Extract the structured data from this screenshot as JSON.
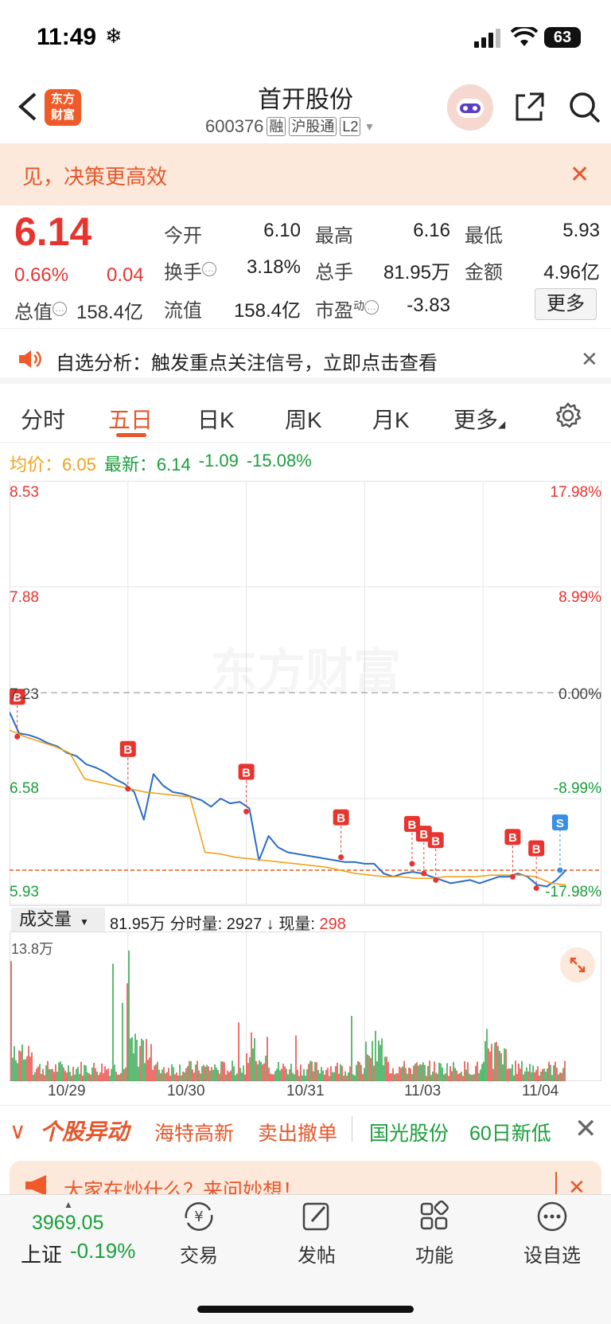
{
  "status_bar": {
    "time": "11:49",
    "battery": "63"
  },
  "header": {
    "logo_line1": "东方",
    "logo_line2": "财富",
    "stock_name": "首开股份",
    "stock_code": "600376",
    "tags": [
      "融",
      "沪股通",
      "L2"
    ]
  },
  "banner": {
    "text": "见，决策更高效"
  },
  "quote": {
    "price": "6.14",
    "pct": "0.66%",
    "change": "0.04",
    "open_label": "今开",
    "open": "6.10",
    "high_label": "最高",
    "high": "6.16",
    "low_label": "最低",
    "low": "5.93",
    "turnover_label": "换手",
    "turnover": "3.18%",
    "volume_label": "总手",
    "volume": "81.95万",
    "amount_label": "金额",
    "amount": "4.96亿",
    "mktcap_label": "总值",
    "mktcap": "158.4亿",
    "float_label": "流值",
    "float": "158.4亿",
    "pe_label": "市盈",
    "pe_sup": "动",
    "pe": "-3.83",
    "more": "更多"
  },
  "alert": {
    "text": "自选分析：触发重点关注信号，立即点击查看"
  },
  "tabs": [
    "分时",
    "五日",
    "日K",
    "周K",
    "月K",
    "更多"
  ],
  "legend": {
    "avg_label": "均价：",
    "avg": "6.05",
    "latest_label": "最新：",
    "latest": "6.14",
    "chg": "-1.09",
    "pct": "-15.08%"
  },
  "chart_data": {
    "type": "line",
    "title": "",
    "x_ticks": [
      "10/29",
      "10/30",
      "10/31",
      "11/03",
      "11/04"
    ],
    "y_left": [
      "8.53",
      "7.88",
      "7.23",
      "6.58",
      "5.93"
    ],
    "y_right": [
      "17.98%",
      "8.99%",
      "0.00%",
      "-8.99%",
      "-17.98%"
    ],
    "ylim": [
      5.93,
      8.53
    ],
    "reference_price": 7.23,
    "current_price": 6.14,
    "series": [
      {
        "name": "",
        "color": "#2b6cc4",
        "values": [
          7.11,
          6.98,
          6.97,
          6.95,
          6.92,
          6.9,
          6.86,
          6.84,
          6.79,
          6.77,
          6.74,
          6.7,
          6.67,
          6.62,
          6.45,
          6.73,
          6.66,
          6.62,
          6.61,
          6.59,
          6.57,
          6.53,
          6.58,
          6.55,
          6.56,
          6.52,
          6.2,
          6.35,
          6.28,
          6.25,
          6.24,
          6.23,
          6.22,
          6.21,
          6.2,
          6.19,
          6.19,
          6.18,
          6.18,
          6.12,
          6.1,
          6.12,
          6.13,
          6.12,
          6.1,
          6.08,
          6.06,
          6.07,
          6.08,
          6.06,
          6.08,
          6.1,
          6.1,
          6.12,
          6.1,
          6.05,
          6.04,
          6.08,
          6.14
        ]
      },
      {
        "name": "",
        "color": "#f0a21a",
        "values": [
          7.0,
          6.96,
          6.93,
          6.9,
          6.86,
          6.7,
          6.68,
          6.66,
          6.64,
          6.62,
          6.61,
          6.6,
          6.59,
          6.25,
          6.24,
          6.22,
          6.21,
          6.2,
          6.19,
          6.18,
          6.17,
          6.16,
          6.14,
          6.12,
          6.11,
          6.1,
          6.1,
          6.09,
          6.09,
          6.1,
          6.1,
          6.1,
          6.11,
          6.11,
          6.11,
          6.1,
          6.06,
          6.05
        ]
      }
    ],
    "markers": [
      {
        "label": "B",
        "x": 0.013,
        "price": 6.96
      },
      {
        "label": "B",
        "x": 0.2,
        "price": 6.64
      },
      {
        "label": "B",
        "x": 0.4,
        "price": 6.5
      },
      {
        "label": "B",
        "x": 0.56,
        "price": 6.22
      },
      {
        "label": "B",
        "x": 0.68,
        "price": 6.18
      },
      {
        "label": "B",
        "x": 0.7,
        "price": 6.12
      },
      {
        "label": "B",
        "x": 0.72,
        "price": 6.08
      },
      {
        "label": "B",
        "x": 0.85,
        "price": 6.1
      },
      {
        "label": "B",
        "x": 0.89,
        "price": 6.03
      },
      {
        "label": "S",
        "x": 0.93,
        "price": 6.14
      }
    ]
  },
  "volume": {
    "selector": "成交量",
    "total": "81.95万",
    "period_label": "分时量:",
    "period": "2927",
    "cur_label": "现量:",
    "cur": "298",
    "max": "13.8万"
  },
  "movers": {
    "title": "个股异动",
    "items": [
      {
        "text": "海特高新",
        "color": "#e5572b"
      },
      {
        "text": "卖出撤单",
        "color": "#e5572b"
      },
      {
        "text": "国光股份",
        "color": "#1a9e3a"
      },
      {
        "text": "60日新低",
        "color": "#1a9e3a"
      }
    ]
  },
  "ad": {
    "text": "大家在炒什么？来问妙想！"
  },
  "bottom": {
    "index_value": "3969.05",
    "index_name": "上证",
    "index_pct": "-0.19%",
    "nav": [
      {
        "label": "交易",
        "icon": "yuan-cycle-icon"
      },
      {
        "label": "发帖",
        "icon": "edit-icon"
      },
      {
        "label": "功能",
        "icon": "grid-icon"
      },
      {
        "label": "设自选",
        "icon": "more-icon"
      }
    ]
  }
}
